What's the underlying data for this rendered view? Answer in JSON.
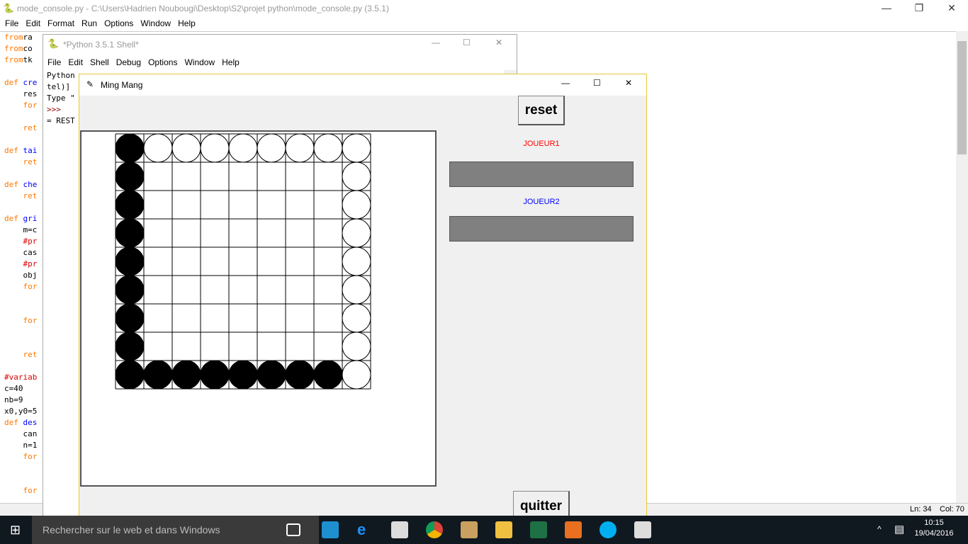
{
  "editor": {
    "title": "mode_console.py - C:\\Users\\Hadrien Noubougi\\Desktop\\S2\\projet python\\mode_console.py (3.5.1)",
    "menu": [
      "File",
      "Edit",
      "Format",
      "Run",
      "Options",
      "Window",
      "Help"
    ],
    "code": [
      [
        [
          "kw",
          "from"
        ],
        [
          "",
          "ra"
        ]
      ],
      [
        [
          "kw",
          "from"
        ],
        [
          "",
          "co"
        ]
      ],
      [
        [
          "kw",
          "from"
        ],
        [
          "",
          "tk"
        ]
      ],
      [],
      [
        [
          "kw",
          "def"
        ],
        [
          "fn",
          " cre"
        ]
      ],
      [
        [
          "",
          "    res"
        ]
      ],
      [
        [
          "kw",
          "    for"
        ]
      ],
      [],
      [
        [
          "kw",
          "    ret"
        ]
      ],
      [],
      [
        [
          "kw",
          "def"
        ],
        [
          "fn",
          " tai"
        ]
      ],
      [
        [
          "kw",
          "    ret"
        ]
      ],
      [],
      [
        [
          "kw",
          "def"
        ],
        [
          "fn",
          " che"
        ]
      ],
      [
        [
          "kw",
          "    ret"
        ]
      ],
      [],
      [
        [
          "kw",
          "def"
        ],
        [
          "fn",
          " gri"
        ]
      ],
      [
        [
          "",
          "    m=c"
        ]
      ],
      [
        [
          "cm",
          "    #pr"
        ]
      ],
      [
        [
          "",
          "    cas"
        ]
      ],
      [
        [
          "cm",
          "    #pr"
        ]
      ],
      [
        [
          "",
          "    obj"
        ]
      ],
      [
        [
          "kw",
          "    for"
        ]
      ],
      [],
      [],
      [
        [
          "kw",
          "    for"
        ]
      ],
      [],
      [],
      [
        [
          "kw",
          "    ret"
        ]
      ],
      [],
      [
        [
          "cm",
          "#variab"
        ]
      ],
      [
        [
          "",
          "c=40"
        ]
      ],
      [
        [
          "",
          "nb=9"
        ]
      ],
      [
        [
          "",
          "x0,y0=5"
        ]
      ],
      [
        [
          "kw",
          "def"
        ],
        [
          "fn",
          " des"
        ]
      ],
      [
        [
          "",
          "    can"
        ]
      ],
      [
        [
          "",
          "    n=1"
        ]
      ],
      [
        [
          "kw",
          "    for"
        ]
      ],
      [],
      [],
      [
        [
          "kw",
          "    for"
        ]
      ]
    ],
    "status": {
      "ln": "Ln: 34",
      "col": "Col: 70"
    }
  },
  "shell": {
    "title": "*Python 3.5.1 Shell*",
    "menu": [
      "File",
      "Edit",
      "Shell",
      "Debug",
      "Options",
      "Window",
      "Help"
    ],
    "lines": [
      "Python",
      "tel)]",
      "Type \"",
      ">>>",
      "= REST"
    ]
  },
  "game": {
    "title": "Ming Mang",
    "reset": "reset",
    "quit": "quitter",
    "player1": "JOUEUR1",
    "player2": "JOUEUR2",
    "player1_color": "#ff0000",
    "player2_color": "#0000ff",
    "player1_value": "",
    "player2_value": "",
    "board_size": 9,
    "black": [
      [
        0,
        0
      ],
      [
        1,
        0
      ],
      [
        2,
        0
      ],
      [
        3,
        0
      ],
      [
        4,
        0
      ],
      [
        5,
        0
      ],
      [
        6,
        0
      ],
      [
        7,
        0
      ],
      [
        8,
        0
      ],
      [
        8,
        1
      ],
      [
        8,
        2
      ],
      [
        8,
        3
      ],
      [
        8,
        4
      ],
      [
        8,
        5
      ],
      [
        8,
        6
      ],
      [
        8,
        7
      ]
    ],
    "white": [
      [
        0,
        1
      ],
      [
        0,
        2
      ],
      [
        0,
        3
      ],
      [
        0,
        4
      ],
      [
        0,
        5
      ],
      [
        0,
        6
      ],
      [
        0,
        7
      ],
      [
        0,
        8
      ],
      [
        1,
        8
      ],
      [
        2,
        8
      ],
      [
        3,
        8
      ],
      [
        4,
        8
      ],
      [
        5,
        8
      ],
      [
        6,
        8
      ],
      [
        7,
        8
      ],
      [
        8,
        8
      ]
    ]
  },
  "taskbar": {
    "search": "Rechercher sur le web et dans Windows",
    "time": "10:15",
    "date": "19/04/2016"
  }
}
